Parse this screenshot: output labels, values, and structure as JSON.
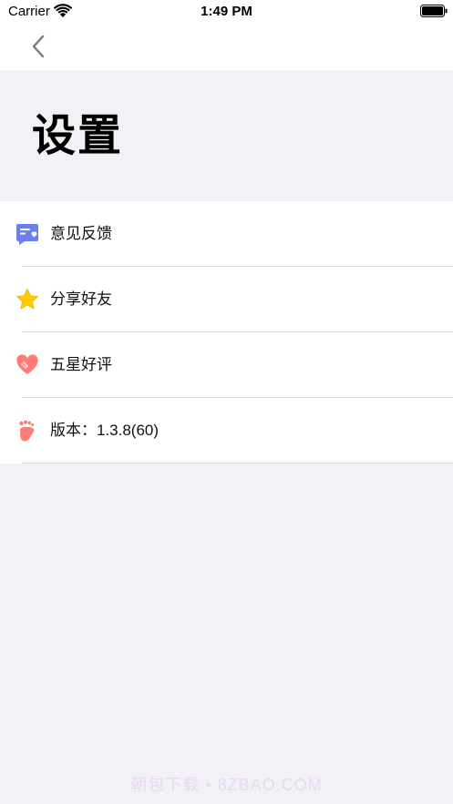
{
  "status_bar": {
    "carrier": "Carrier",
    "time": "1:49 PM",
    "wifi_icon": "wifi-icon",
    "battery_icon": "battery-icon"
  },
  "nav": {
    "back_icon": "chevron-left-icon"
  },
  "page": {
    "title": "设置"
  },
  "settings": {
    "items": [
      {
        "label": "意见反馈",
        "icon": "feedback-icon",
        "color": "#6b7ff0"
      },
      {
        "label": "分享好友",
        "icon": "star-icon",
        "color": "#ffcc00"
      },
      {
        "label": "五星好评",
        "icon": "heart-icon",
        "color": "#ff7b74"
      },
      {
        "label": "版本：1.3.8(60)",
        "icon": "footprint-icon",
        "color": "#ff7b74"
      }
    ]
  },
  "watermark": {
    "text": "朝包下载 • 8ZBAO.COM"
  },
  "colors": {
    "background": "#f2f1f6",
    "surface": "#ffffff",
    "separator": "#dcdce0"
  }
}
